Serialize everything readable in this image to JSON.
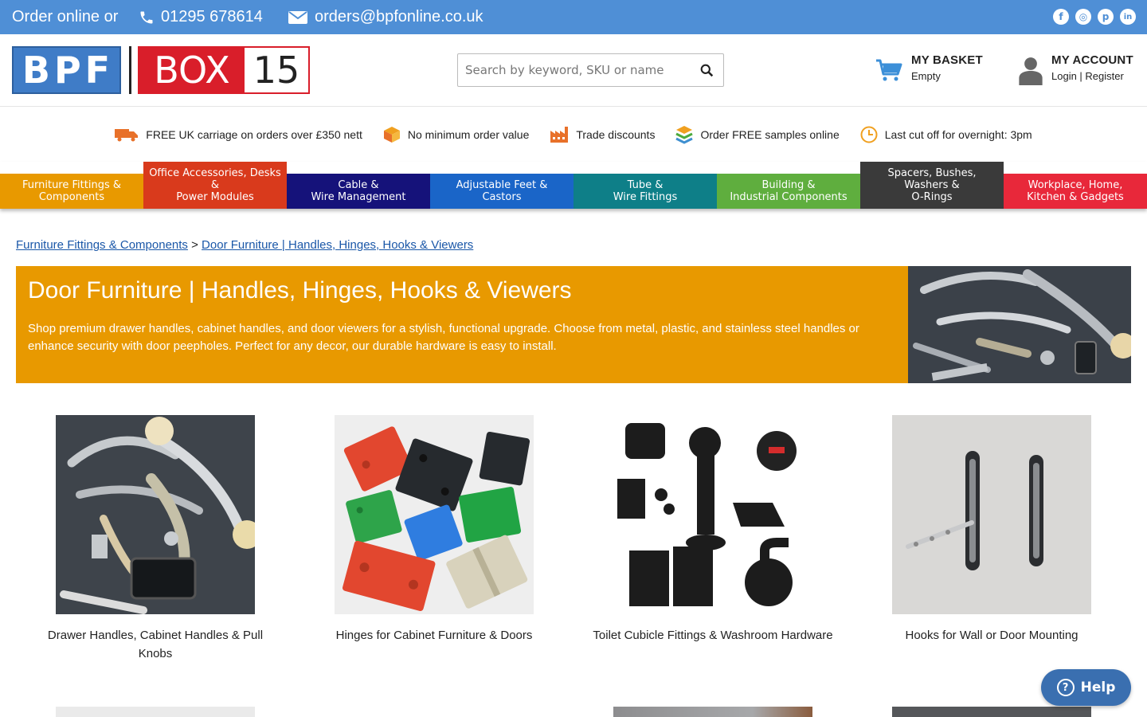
{
  "topbar": {
    "order_text": "Order online or",
    "phone": "01295 678614",
    "email": "orders@bpfonline.co.uk",
    "social": [
      "f",
      "◎",
      "p",
      "in"
    ]
  },
  "header": {
    "logo_left": [
      "B",
      "P",
      "F"
    ],
    "logo_box": "BOX",
    "logo_num": "15",
    "search_placeholder": "Search by keyword, SKU or name",
    "basket_title": "MY BASKET",
    "basket_status": "Empty",
    "account_title": "MY ACCOUNT",
    "account_links": "Login | Register"
  },
  "usp": [
    {
      "icon": "delivery-truck-icon",
      "text": "FREE UK carriage on orders over £350 nett"
    },
    {
      "icon": "package-icon",
      "text": "No minimum order value"
    },
    {
      "icon": "factory-icon",
      "text": "Trade discounts"
    },
    {
      "icon": "layers-icon",
      "text": "Order FREE samples online"
    },
    {
      "icon": "clock-icon",
      "text": "Last cut off for overnight: 3pm"
    }
  ],
  "nav": [
    {
      "label": "Furniture Fittings &\nComponents",
      "color": "#e89900",
      "tall": false
    },
    {
      "label": "Office Accessories, Desks &\nPower Modules",
      "color": "#d93a1c",
      "tall": true
    },
    {
      "label": "Cable &\nWire Management",
      "color": "#15127a",
      "tall": false
    },
    {
      "label": "Adjustable Feet &\nCastors",
      "color": "#1a65c8",
      "tall": false
    },
    {
      "label": "Tube &\nWire Fittings",
      "color": "#0e7f88",
      "tall": false
    },
    {
      "label": "Building &\nIndustrial Components",
      "color": "#5fae3e",
      "tall": false
    },
    {
      "label": "Spacers, Bushes,\nWashers &\nO-Rings",
      "color": "#3a3a3a",
      "tall": true
    },
    {
      "label": "Workplace, Home,\nKitchen & Gadgets",
      "color": "#e8283a",
      "tall": false
    }
  ],
  "breadcrumb": {
    "parent": "Furniture Fittings & Components",
    "separator": ">",
    "current": "Door Furniture | Handles, Hinges, Hooks & Viewers"
  },
  "banner": {
    "title": "Door Furniture | Handles, Hinges, Hooks & Viewers",
    "description": "Shop premium drawer handles, cabinet handles, and door viewers for a stylish, functional upgrade. Choose from metal, plastic, and stainless steel handles or enhance security with door peepholes. Perfect for any decor, our durable hardware is easy to install."
  },
  "products": [
    {
      "name": "Drawer Handles, Cabinet Handles & Pull Knobs"
    },
    {
      "name": "Hinges for Cabinet Furniture & Doors"
    },
    {
      "name": "Toilet Cubicle Fittings & Washroom Hardware"
    },
    {
      "name": "Hooks for Wall or Door Mounting"
    }
  ],
  "help": {
    "label": "Help"
  },
  "colors": {
    "topbar": "#4f8fd6",
    "banner": "#e89900",
    "link": "#1a57a8"
  }
}
